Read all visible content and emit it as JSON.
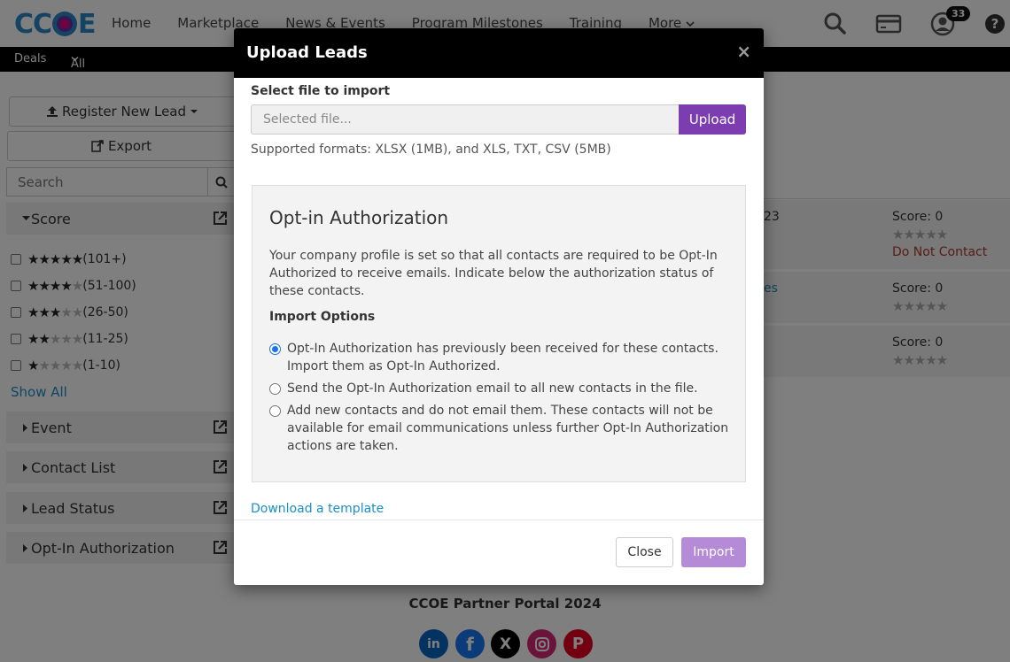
{
  "nav": {
    "logo": "CCOE",
    "links": [
      "Home",
      "Marketplace",
      "News & Events",
      "Program Milestones",
      "Training",
      "More"
    ],
    "notification_count": "33"
  },
  "subnav": {
    "deals": "Deals",
    "all_leads": "All Leads"
  },
  "sidebar": {
    "register_label": "Register New Lead",
    "export_label": "Export",
    "search_placeholder": "Search",
    "score_facet": "Score",
    "score_rows": [
      {
        "stars": 5,
        "label": "(101+)"
      },
      {
        "stars": 4,
        "label": "(51-100)"
      },
      {
        "stars": 3,
        "label": "(26-50)"
      },
      {
        "stars": 2,
        "label": "(11-25)"
      },
      {
        "stars": 1,
        "label": "(1-10)"
      }
    ],
    "show_all": "Show All",
    "facets": [
      "Event",
      "Contact List",
      "Lead Status",
      "Opt-In Authorization"
    ]
  },
  "leads": [
    {
      "score": "Score: 0",
      "status": "Do Not Contact",
      "fragment": "23"
    },
    {
      "score": "Score: 0",
      "status": "",
      "fragment": "es"
    },
    {
      "score": "Score: 0",
      "status": "",
      "fragment": ""
    }
  ],
  "footer": {
    "title": "CCOE Partner Portal 2024"
  },
  "modal": {
    "title": "Upload Leads",
    "file_label": "Select file to import",
    "file_placeholder": "Selected file...",
    "upload_label": "Upload",
    "formats": "Supported formats: XLSX (1MB), and XLS, TXT, CSV (5MB)",
    "auth_title": "Opt-in Authorization",
    "auth_desc": "Your company profile is set so that all contacts are required to be Opt-In Authorized to receive emails. Indicate below the authorization status of these contacts.",
    "import_options": "Import Options",
    "options": [
      {
        "text": "Opt-In Authorization has previously been received for these contacts. Import them as Opt-In Authorized.",
        "selected": true
      },
      {
        "text": "Send the Opt-In Authorization email to all new contacts in the file.",
        "selected": false
      },
      {
        "text": "Add new contacts and do not email them. These contacts will not be available for email communications unless further Opt-In Authorization actions are taken.",
        "selected": false
      }
    ],
    "download_template": "Download a template",
    "close_label": "Close",
    "import_label": "Import"
  },
  "colors": {
    "accent": "#7b3db0",
    "link": "#1a8fc8",
    "import_disabled": "#b58ad6"
  }
}
